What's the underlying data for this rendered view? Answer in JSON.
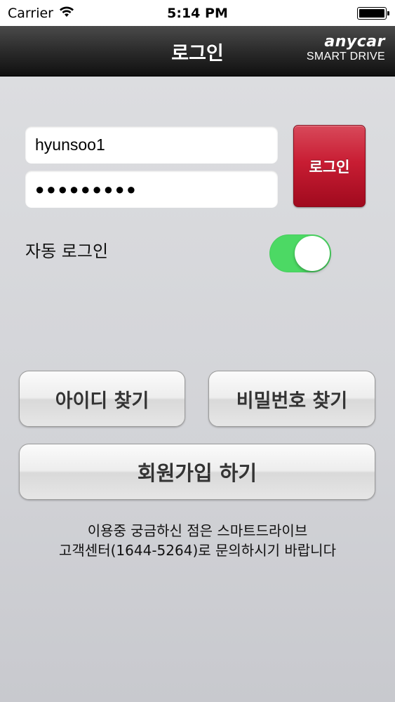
{
  "status_bar": {
    "carrier": "Carrier",
    "time": "5:14 PM",
    "wifi_icon": "wifi-icon",
    "battery_icon": "battery-icon"
  },
  "nav": {
    "title": "로그인",
    "brand_name": "anycar",
    "brand_sub": "SMART DRIVE"
  },
  "login_form": {
    "user_id": "hyunsoo1",
    "password_masked": "●●●●●●●●●",
    "login_button": "로그인"
  },
  "auto_login": {
    "label": "자동 로그인",
    "enabled": true
  },
  "buttons": {
    "find_id": "아이디 찾기",
    "find_password": "비밀번호 찾기",
    "signup": "회원가입 하기"
  },
  "notice": {
    "line1": "이용중 궁금하신 점은 스마트드라이브",
    "line2": "고객센터(1644-5264)로 문의하시기 바랍니다"
  },
  "colors": {
    "accent_red": "#c81d33",
    "toggle_on": "#4cd964",
    "nav_dark": "#1a1a1a"
  }
}
